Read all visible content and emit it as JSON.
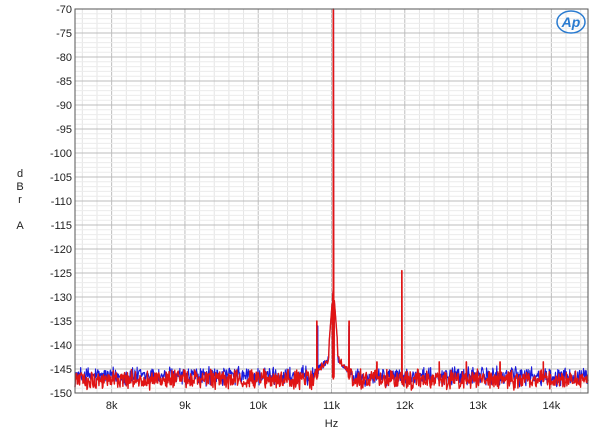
{
  "chart_data": {
    "type": "line",
    "title": "",
    "xlabel": "Hz",
    "ylabel_lines": [
      "d",
      "B",
      "r",
      "",
      "A"
    ],
    "xlim": [
      7500,
      14500
    ],
    "ylim": [
      -150,
      -70
    ],
    "x_scale": "linear",
    "grid": true,
    "x_ticks": [
      8000,
      9000,
      10000,
      11000,
      12000,
      13000,
      14000
    ],
    "x_tick_labels": [
      "8k",
      "9k",
      "10k",
      "11k",
      "12k",
      "13k",
      "14k"
    ],
    "y_ticks": [
      -70,
      -75,
      -80,
      -85,
      -90,
      -95,
      -100,
      -105,
      -110,
      -115,
      -120,
      -125,
      -130,
      -135,
      -140,
      -145,
      -150
    ],
    "y_tick_labels": [
      "-70",
      "-75",
      "-80",
      "-85",
      "-90",
      "-95",
      "-100",
      "-105",
      "-110",
      "-115",
      "-120",
      "-125",
      "-130",
      "-135",
      "-140",
      "-145",
      "-150"
    ],
    "series": [
      {
        "color": "#1a1adc",
        "noise_floor_db": -146.5,
        "peaks": [
          {
            "x": 11025,
            "y": -70
          },
          {
            "x": 10810,
            "y": -136
          },
          {
            "x": 11240,
            "y": -136
          }
        ]
      },
      {
        "color": "#e01414",
        "noise_floor_db": -147.2,
        "peaks": [
          {
            "x": 11025,
            "y": -70
          },
          {
            "x": 10800,
            "y": -135
          },
          {
            "x": 11240,
            "y": -135
          },
          {
            "x": 11960,
            "y": -124.5
          },
          {
            "x": 11620,
            "y": -143.5
          },
          {
            "x": 12470,
            "y": -143.5
          },
          {
            "x": 12840,
            "y": -143.5
          },
          {
            "x": 13300,
            "y": -143.5
          },
          {
            "x": 13890,
            "y": -143.5
          }
        ]
      }
    ],
    "logo": {
      "text": "Ap",
      "color": "#2a7bd0"
    }
  }
}
